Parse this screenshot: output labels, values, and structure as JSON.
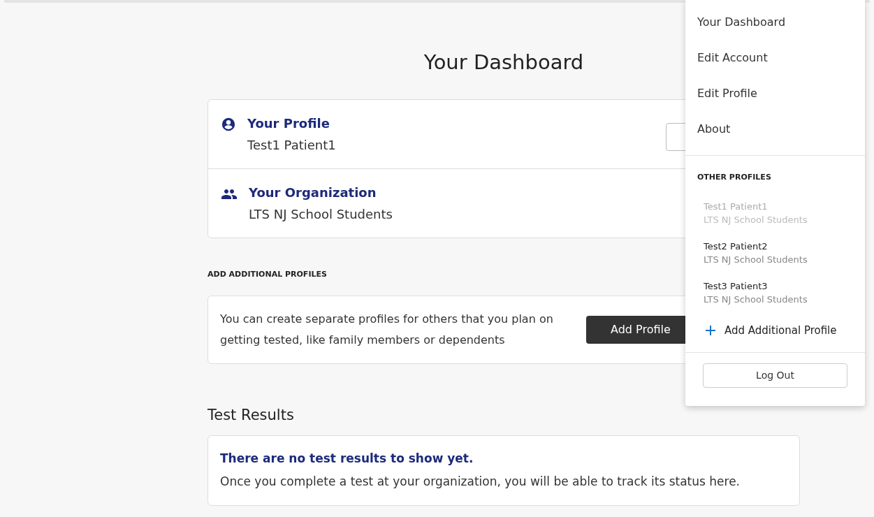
{
  "page_title": "Your Dashboard",
  "info_card": {
    "rows": [
      {
        "kind": "profile",
        "heading": "Your Profile",
        "value": "Test1 Patient1"
      },
      {
        "kind": "organization",
        "heading": "Your Organization",
        "value": "LTS NJ School Students"
      }
    ]
  },
  "add_profiles": {
    "heading": "ADD ADDITIONAL PROFILES",
    "text": "You can create separate profiles for others that you plan on getting tested, like family members or dependents",
    "button": "Add Profile"
  },
  "test_results": {
    "heading": "Test Results",
    "title": "There are no test results to show yet.",
    "text": "Once you complete a test at your organization, you will be able to track its status here."
  },
  "menu": {
    "items": [
      "Your Dashboard",
      "Edit Account",
      "Edit Profile",
      "About"
    ],
    "section_heading": "OTHER PROFILES",
    "profiles": [
      {
        "name": "Test1 Patient1",
        "organization": "LTS NJ School Students",
        "disabled": true
      },
      {
        "name": "Test2 Patient2",
        "organization": "LTS NJ School Students",
        "disabled": false
      },
      {
        "name": "Test3 Patient3",
        "organization": "LTS NJ School Students",
        "disabled": false
      }
    ],
    "add_link": "Add Additional Profile",
    "logout": "Log Out"
  }
}
